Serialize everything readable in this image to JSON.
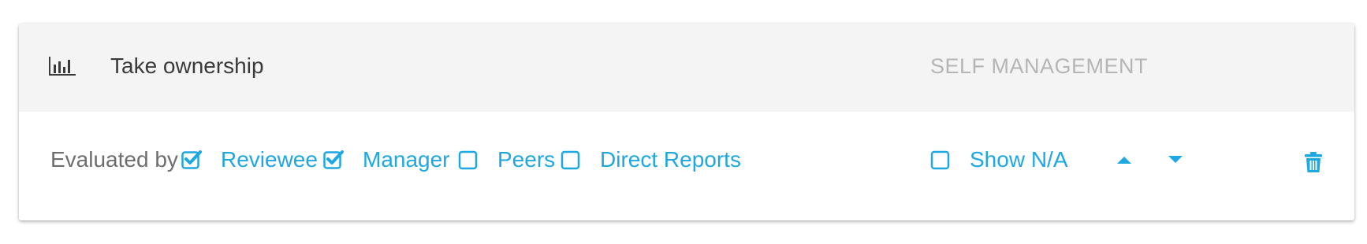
{
  "card": {
    "title": "Take ownership",
    "category": "SELF MANAGEMENT",
    "icon": "bar-chart-icon"
  },
  "evaluation": {
    "label": "Evaluated by",
    "options": [
      {
        "label": "Reviewee",
        "checked": true
      },
      {
        "label": "Manager",
        "checked": true
      },
      {
        "label": "Peers",
        "checked": false
      },
      {
        "label": "Direct Reports",
        "checked": false
      }
    ],
    "show_na": {
      "label": "Show N/A",
      "checked": false
    }
  },
  "actions": {
    "move_up_icon": "caret-up-icon",
    "move_down_icon": "caret-down-icon",
    "delete_icon": "trash-icon"
  },
  "colors": {
    "accent": "#1ea7e1",
    "header_bg": "#f4f4f4",
    "title": "#3a3a3a",
    "category": "#b5b5b5",
    "label": "#6e6e6e"
  }
}
